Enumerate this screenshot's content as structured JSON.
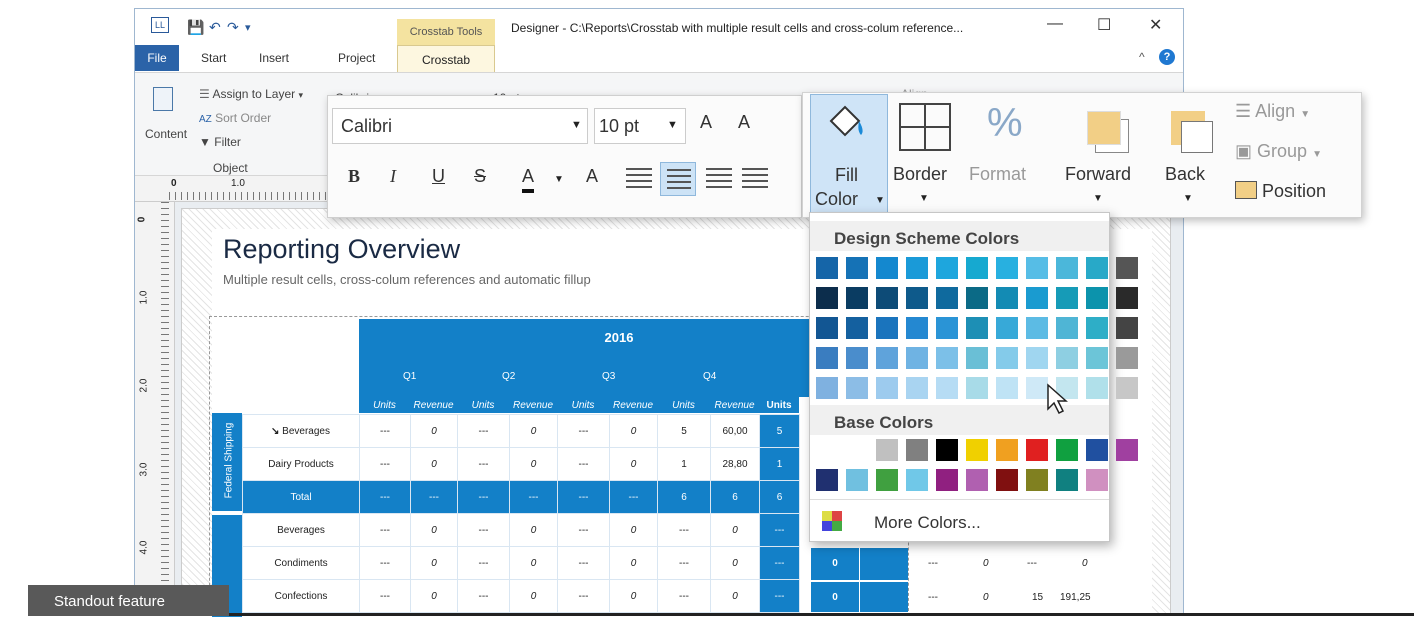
{
  "window": {
    "title": "Designer - C:\\Reports\\Crosstab with multiple result cells and cross-colum reference...",
    "context_tab_group": "Crosstab Tools",
    "minimize": "—",
    "maximize": "☐",
    "close": "✕"
  },
  "ribbon_tabs": [
    "File",
    "Start",
    "Insert",
    "Project",
    "Crosstab"
  ],
  "object_group": {
    "content": "Content",
    "assign_layer": "Assign to Layer",
    "sort_order": "Sort Order",
    "filter": "Filter",
    "label": "Object"
  },
  "ribbon_font_name": "Calibri",
  "ribbon_font_size": "10 pt",
  "ribbon_align": "Align",
  "ruler": {
    "h0": "0",
    "h1": "1.0",
    "v0": "0",
    "v1": "1.0",
    "v2": "2.0",
    "v3": "3.0",
    "v4": "4.0"
  },
  "report": {
    "title": "Reporting Overview",
    "subtitle": "Multiple result cells, cross-colum references and automatic fillup"
  },
  "crosstab": {
    "year": "2016",
    "quarters": [
      "Q1",
      "Q2",
      "Q3",
      "Q4"
    ],
    "measures": [
      "Units",
      "Revenue",
      "Units",
      "Revenue",
      "Units",
      "Revenue",
      "Units",
      "Revenue",
      "Units"
    ],
    "group_label": "Federal Shipping",
    "rows": [
      {
        "name": "Beverages",
        "cells": [
          "---",
          "0",
          "---",
          "0",
          "---",
          "0",
          "5",
          "60,00",
          "5"
        ]
      },
      {
        "name": "Dairy Products",
        "cells": [
          "---",
          "0",
          "---",
          "0",
          "---",
          "0",
          "1",
          "28,80",
          "1"
        ]
      },
      {
        "name": "Total",
        "cells": [
          "---",
          "---",
          "---",
          "---",
          "---",
          "---",
          "6",
          "6",
          "6"
        ]
      },
      {
        "name": "Beverages",
        "cells": [
          "---",
          "0",
          "---",
          "0",
          "---",
          "0",
          "---",
          "0",
          "---"
        ]
      },
      {
        "name": "Condiments",
        "cells": [
          "---",
          "0",
          "---",
          "0",
          "---",
          "0",
          "---",
          "0",
          "---"
        ]
      },
      {
        "name": "Confections",
        "cells": [
          "---",
          "0",
          "---",
          "0",
          "---",
          "0",
          "---",
          "0",
          "---"
        ]
      }
    ],
    "right_cells_row5": [
      "0",
      "",
      "---",
      "0",
      "---",
      "0"
    ],
    "right_cells_row6": [
      "0",
      "",
      "---",
      "0",
      "15",
      "191,25"
    ]
  },
  "float_toolbar": {
    "font_name": "Calibri",
    "font_size": "10 pt",
    "grow_font": "A",
    "shrink_font": "A",
    "bold": "B",
    "italic": "I",
    "underline": "U",
    "strike": "S",
    "font_color": "A",
    "highlight": "A"
  },
  "arrange": {
    "fill_color": "Fill Color",
    "fill_color_line1": "Fill",
    "fill_color_line2": "Color",
    "border": "Border",
    "format": "Format",
    "format_icon": "%",
    "forward": "Forward",
    "back": "Back",
    "align": "Align",
    "group": "Group",
    "position": "Position"
  },
  "color_menu": {
    "scheme_header": "Design Scheme Colors",
    "base_header": "Base Colors",
    "more_colors": "More Colors...",
    "scheme_rows": [
      [
        "#1565a8",
        "#1572b6",
        "#1488cf",
        "#1a9ad8",
        "#1ea6dd",
        "#16a9d0",
        "#28b0e0",
        "#56bde6",
        "#4bb7da",
        "#28a9c8",
        "#555555"
      ],
      [
        "#0c2d4c",
        "#0a3c62",
        "#0d4b77",
        "#0e5a8b",
        "#0f6a9e",
        "#0b6a86",
        "#138bb4",
        "#1a9bd0",
        "#169bb7",
        "#0c93ac",
        "#2a2a2a"
      ],
      [
        "#125693",
        "#14609f",
        "#1a74bd",
        "#2488d1",
        "#2a94d6",
        "#1d8fb5",
        "#37a9d8",
        "#5cbbe4",
        "#4fb5d5",
        "#2eaec7",
        "#444444"
      ],
      [
        "#3a7dc0",
        "#4a8dcc",
        "#5fa3db",
        "#6fb3e3",
        "#7cc0e8",
        "#6abfd6",
        "#84cbea",
        "#a0d6f0",
        "#8ecfe2",
        "#6cc5d8",
        "#9a9a9a"
      ],
      [
        "#7fb1e0",
        "#8cbde6",
        "#9dcbee",
        "#a9d4f1",
        "#b6dcf4",
        "#a8dbe8",
        "#bfe3f5",
        "#cfe9f7",
        "#c3e6ef",
        "#b0e0ea",
        "#c7c7c7"
      ]
    ],
    "base_row1": [
      "#ffffff",
      "#c0c0c0",
      "#808080",
      "#000000",
      "#f0d000",
      "#f0a020",
      "#e02020",
      "#10a040",
      "#2050a0",
      "#a040a0"
    ],
    "base_row2": [
      "#203070",
      "#70c0e0",
      "#40a040",
      "#70c8e8",
      "#902080",
      "#b060b0",
      "#801010",
      "#808020",
      "#108080",
      "#d090c0"
    ]
  },
  "footer_badge": "Standout feature"
}
